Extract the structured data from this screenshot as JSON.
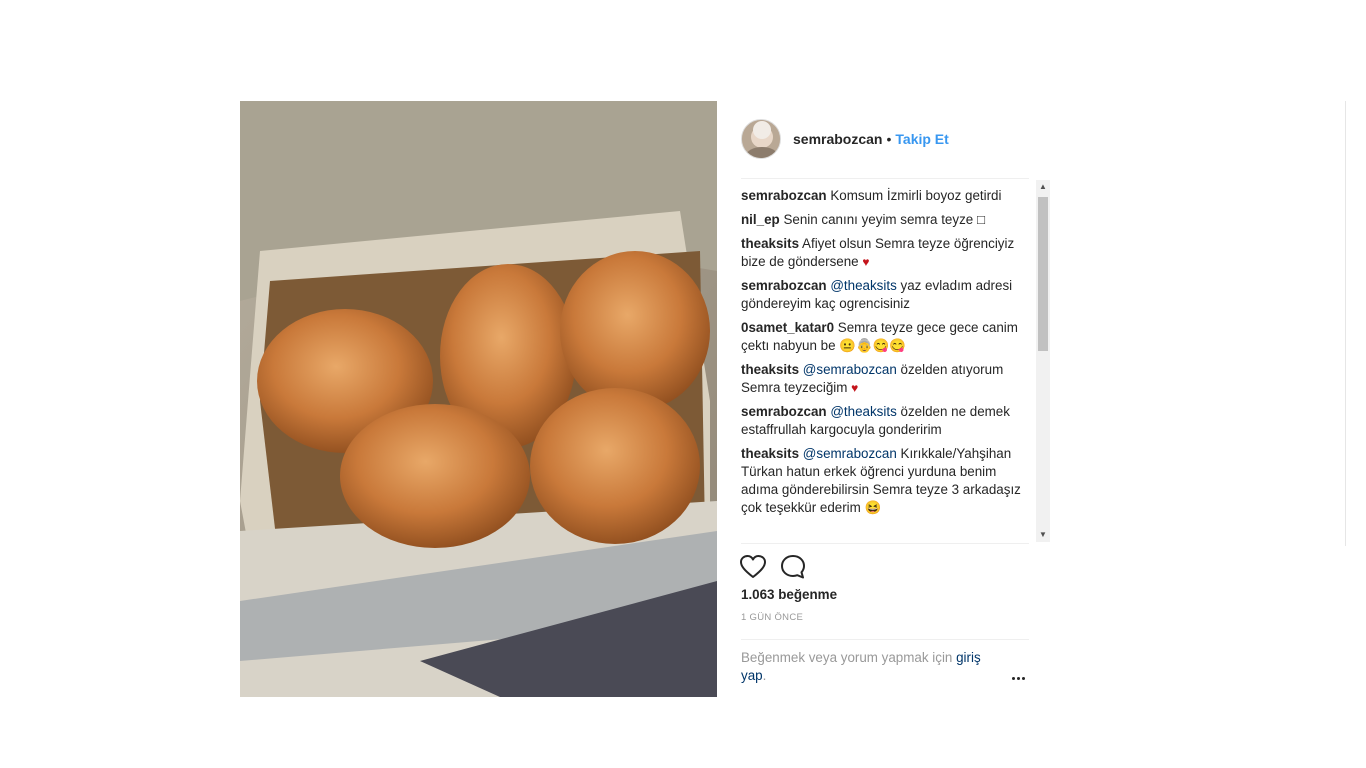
{
  "post": {
    "username": "semrabozcan",
    "dot": "•",
    "follow_label": "Takip Et",
    "comments": [
      {
        "user": "semrabozcan",
        "parts": [
          {
            "t": "text",
            "v": "Komsum İzmirli boyoz getirdi"
          }
        ]
      },
      {
        "user": "nil_ep",
        "parts": [
          {
            "t": "text",
            "v": "Senin canını yeyim semra teyze"
          },
          {
            "t": "box"
          }
        ]
      },
      {
        "user": "theaksits",
        "parts": [
          {
            "t": "text",
            "v": "Afiyet olsun Semra teyze öğrenciyiz bize de göndersene"
          },
          {
            "t": "heart"
          }
        ]
      },
      {
        "user": "semrabozcan",
        "parts": [
          {
            "t": "mention",
            "v": "@theaksits"
          },
          {
            "t": "text",
            "v": "yaz evladım adresi göndereyim kaç ogrencisiniz"
          }
        ]
      },
      {
        "user": "0samet_katar0",
        "parts": [
          {
            "t": "text",
            "v": "Semra teyze gece gece canim çektı nabyun be"
          },
          {
            "t": "emoji",
            "v": "😐👵😋😋"
          }
        ]
      },
      {
        "user": "theaksits",
        "parts": [
          {
            "t": "mention",
            "v": "@semrabozcan"
          },
          {
            "t": "text",
            "v": "özelden atıyorum Semra teyzeciğim"
          },
          {
            "t": "heart"
          }
        ]
      },
      {
        "user": "semrabozcan",
        "parts": [
          {
            "t": "mention",
            "v": "@theaksits"
          },
          {
            "t": "text",
            "v": "özelden ne demek estaffrullah kargocuyla gonderirim"
          }
        ]
      },
      {
        "user": "theaksits",
        "parts": [
          {
            "t": "mention",
            "v": "@semrabozcan"
          },
          {
            "t": "text",
            "v": "Kırıkkale/Yahşihan Türkan hatun erkek öğrenci yurduna benim adıma gönderebilirsin Semra teyze 3 arkadaşız çok teşekkür ederim"
          },
          {
            "t": "emoji",
            "v": "😆"
          }
        ]
      }
    ],
    "likes": "1.063 beğenme",
    "time": "1 GÜN ÖNCE",
    "login_prefix": "Beğenmek veya yorum yapmak için",
    "login_link": "giriş yap",
    "login_suffix": "."
  },
  "glyphs": {
    "heart": "♥",
    "box": "□",
    "scroll_up": "▲",
    "scroll_down": "▼"
  },
  "icons": {
    "like": "heart-outline-icon",
    "comment": "speech-bubble-icon",
    "more": "more-options-icon"
  },
  "colors": {
    "link_blue": "#3897f0",
    "mention": "#003569",
    "muted": "#999999",
    "heart_red": "#c4141b"
  }
}
